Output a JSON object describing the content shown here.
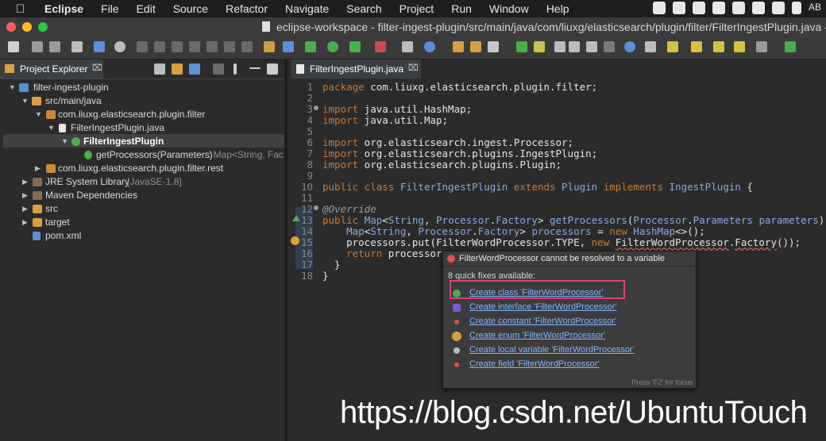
{
  "menubar": {
    "apple": "",
    "app_name": "Eclipse",
    "items": [
      "File",
      "Edit",
      "Source",
      "Refactor",
      "Navigate",
      "Search",
      "Project",
      "Run",
      "Window",
      "Help"
    ],
    "tray_text": "AB"
  },
  "window": {
    "title": "eclipse-workspace - filter-ingest-plugin/src/main/java/com/liuxg/elasticsearch/plugin/filter/FilterIngestPlugin.java -"
  },
  "explorer": {
    "tab_label": "Project Explorer",
    "tab_close": "⌧",
    "tree": [
      {
        "label": "filter-ingest-plugin",
        "suffix": ""
      },
      {
        "label": "src/main/java",
        "suffix": ""
      },
      {
        "label": "com.liuxg.elasticsearch.plugin.filter",
        "suffix": ""
      },
      {
        "label": "FilterIngestPlugin.java",
        "suffix": ""
      },
      {
        "label": "FilterIngestPlugin",
        "suffix": ""
      },
      {
        "label": "getProcessors(Parameters)",
        "suffix": " : Map<String, Fac"
      },
      {
        "label": "com.liuxg.elasticsearch.plugin.filter.rest",
        "suffix": ""
      },
      {
        "label": "JRE System Library",
        "suffix": " [JavaSE-1.8]"
      },
      {
        "label": "Maven Dependencies",
        "suffix": ""
      },
      {
        "label": "src",
        "suffix": ""
      },
      {
        "label": "target",
        "suffix": ""
      },
      {
        "label": "pom.xml",
        "suffix": ""
      }
    ]
  },
  "editor": {
    "tab_label": "FilterIngestPlugin.java",
    "tab_close": "⌧",
    "line_numbers": [
      "1",
      "2",
      "3",
      "4",
      "5",
      "6",
      "7",
      "8",
      "9",
      "10",
      "11",
      "12",
      "13",
      "14",
      "15",
      "16",
      "17",
      "18"
    ]
  },
  "popup": {
    "message": "FilterWordProcessor cannot be resolved to a variable",
    "count": "8 quick fixes available:",
    "fixes": [
      "Create class 'FilterWordProcessor'",
      "Create interface 'FilterWordProcessor'",
      "Create constant 'FilterWordProcessor'",
      "Create enum 'FilterWordProcessor'",
      "Create local variable 'FilterWordProcessor'",
      "Create field 'FilterWordProcessor'"
    ],
    "hint": "Press 'F2' for focus"
  },
  "watermark": "https://blog.csdn.net/UbuntuTouch",
  "colors": {
    "accent_highlight": "#e0407a",
    "keyword": "#cc7832",
    "link": "#7fb8ff"
  }
}
